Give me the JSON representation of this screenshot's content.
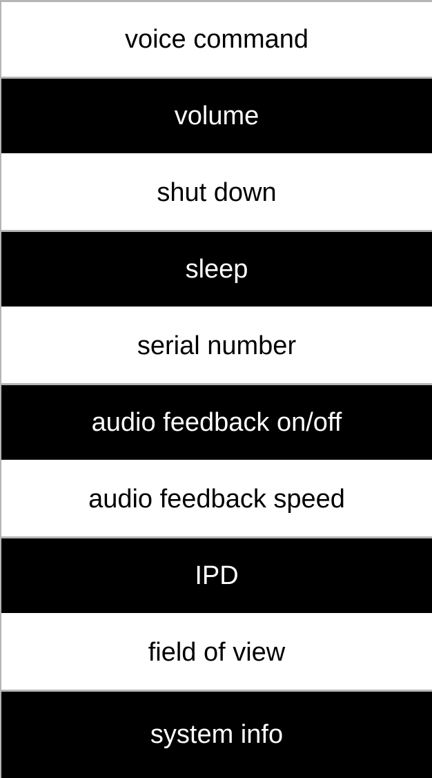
{
  "menu": {
    "items": [
      {
        "label": "voice command",
        "theme": "light"
      },
      {
        "label": "volume",
        "theme": "dark"
      },
      {
        "label": "shut down",
        "theme": "light"
      },
      {
        "label": "sleep",
        "theme": "dark"
      },
      {
        "label": "serial number",
        "theme": "light"
      },
      {
        "label": "audio feedback on/off",
        "theme": "dark"
      },
      {
        "label": "audio feedback speed",
        "theme": "light"
      },
      {
        "label": "IPD",
        "theme": "dark"
      },
      {
        "label": "field of view",
        "theme": "light"
      },
      {
        "label": "system info",
        "theme": "dark"
      }
    ]
  },
  "colors": {
    "light_bg": "#ffffff",
    "dark_bg": "#000000",
    "divider": "#b5b5b5"
  }
}
